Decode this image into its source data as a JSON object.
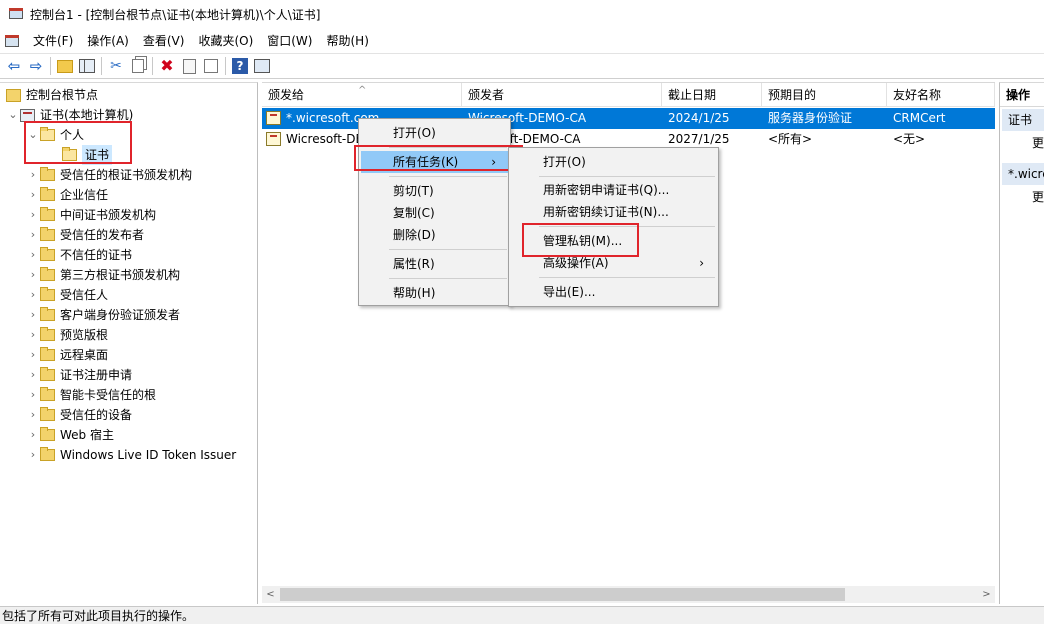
{
  "window": {
    "title": "控制台1 - [控制台根节点\\证书(本地计算机)\\个人\\证书]"
  },
  "menubar": [
    "文件(F)",
    "操作(A)",
    "查看(V)",
    "收藏夹(O)",
    "窗口(W)",
    "帮助(H)"
  ],
  "toolbar": {
    "icons": [
      "back-arrow-icon",
      "forward-arrow-icon",
      "up-folder-icon",
      "show-hide-tree-icon",
      "cut-icon",
      "copy-icon",
      "delete-icon",
      "properties-icon",
      "export-list-icon",
      "help-icon",
      "show-action-pane-icon"
    ]
  },
  "tree": {
    "root": "控制台根节点",
    "cert_store": "证书(本地计算机)",
    "personal": "个人",
    "personal_certs": "证书",
    "folders": [
      "受信任的根证书颁发机构",
      "企业信任",
      "中间证书颁发机构",
      "受信任的发布者",
      "不信任的证书",
      "第三方根证书颁发机构",
      "受信任人",
      "客户端身份验证颁发者",
      "预览版根",
      "远程桌面",
      "证书注册申请",
      "智能卡受信任的根",
      "受信任的设备",
      "Web 宿主",
      "Windows Live ID Token Issuer"
    ]
  },
  "list": {
    "columns": [
      "颁发给",
      "颁发者",
      "截止日期",
      "预期目的",
      "友好名称"
    ],
    "rows": [
      {
        "issued_to": "*.wicresoft.com",
        "issuer": "Wicresoft-DEMO-CA",
        "expires": "2024/1/25",
        "purpose": "服务器身份验证",
        "friendly": "CRMCert",
        "selected": true
      },
      {
        "issued_to": "Wicresoft-DE",
        "issuer": "soft-DEMO-CA",
        "expires": "2027/1/25",
        "purpose": "<所有>",
        "friendly": "<无>",
        "selected": false
      }
    ]
  },
  "actions": {
    "header": "操作",
    "section1": "证书",
    "item1": "更",
    "section2": "*.wicre",
    "item2": "更"
  },
  "context_menu": {
    "items": [
      "打开(O)",
      "所有任务(K)",
      "剪切(T)",
      "复制(C)",
      "删除(D)",
      "属性(R)",
      "帮助(H)"
    ],
    "highlighted": "所有任务(K)"
  },
  "submenu": {
    "items": [
      "打开(O)",
      "用新密钥申请证书(Q)...",
      "用新密钥续订证书(N)...",
      "管理私钥(M)...",
      "高级操作(A)",
      "导出(E)..."
    ]
  },
  "statusbar": {
    "text": "包括了所有可对此项目执行的操作。"
  },
  "colors": {
    "selection": "#0078d7",
    "highlight_box": "#e0242b",
    "menu_hover": "#91c9f7"
  }
}
